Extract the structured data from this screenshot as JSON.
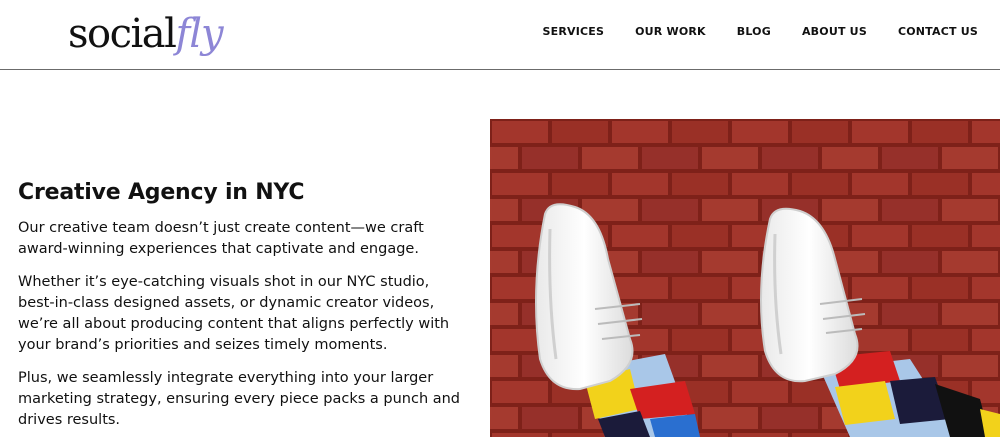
{
  "header": {
    "logo": {
      "main": "social",
      "accent": "fly"
    },
    "nav": [
      {
        "label": "SERVICES"
      },
      {
        "label": "OUR WORK"
      },
      {
        "label": "BLOG"
      },
      {
        "label": "ABOUT US"
      },
      {
        "label": "CONTACT US"
      }
    ]
  },
  "main": {
    "title": "Creative Agency in NYC",
    "paragraphs": [
      "Our creative team doesn’t just create content—we craft award-winning experiences that captivate and engage.",
      "Whether it’s eye-catching visuals shot in our NYC studio, best-in-class designed assets, or dynamic creator videos, we’re all about producing content that aligns perfectly with your brand’s priorities and seizes timely moments.",
      "Plus, we seamlessly integrate everything into your larger marketing strategy, ensuring every piece packs a punch and drives results."
    ]
  },
  "colors": {
    "logo_accent": "#8d86d6",
    "brick": "#9c2f26",
    "text": "#111111",
    "divider": "#6b6b6b"
  }
}
